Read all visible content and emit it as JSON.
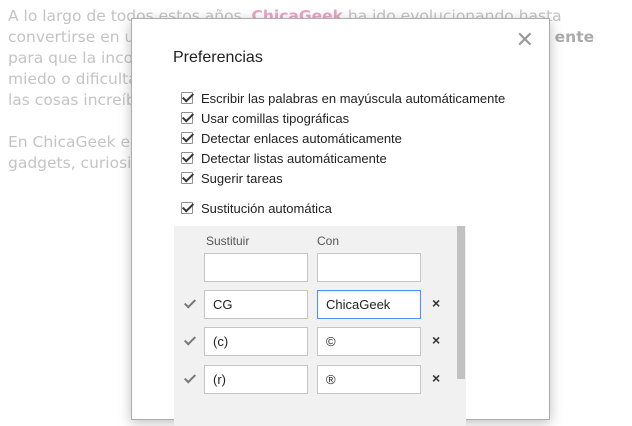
{
  "background": {
    "p1": [
      "A lo largo de todos estos años, ",
      "ChicaGeek",
      " ha ido evolucionando hasta",
      "convertirse en una referencia en el mundo de la tecnología accesible, ",
      "para que la incorporación de la tecnología en la vida de cualquier",
      "miedo o dificultades, y para eso nos esforzamos en enseñarles",
      "las cosas increíbles que hay en el mundo."
    ],
    "p1_bold": "ente",
    "p2": [
      "En ChicaGeek encontrarás noticias, tutoriales, trucos, análisis de",
      "gadgets, curiosidades y todo lo que necesitas saber hoy."
    ]
  },
  "dialog": {
    "title": "Preferencias",
    "close_icon": "close-icon",
    "options": [
      {
        "label": "Escribir las palabras en mayúscula automáticamente",
        "checked": true
      },
      {
        "label": "Usar comillas tipográficas",
        "checked": true
      },
      {
        "label": "Detectar enlaces automáticamente",
        "checked": true
      },
      {
        "label": "Detectar listas automáticamente",
        "checked": true
      },
      {
        "label": "Sugerir tareas",
        "checked": true
      }
    ],
    "auto_sub": {
      "label": "Sustitución automática",
      "checked": true
    },
    "table": {
      "col_replace": "Sustituir",
      "col_with": "Con",
      "new_row": {
        "replace": "",
        "with": ""
      },
      "rows": [
        {
          "checked": true,
          "replace": "CG",
          "with": "ChicaGeek"
        },
        {
          "checked": true,
          "replace": "(c)",
          "with": "©"
        },
        {
          "checked": true,
          "replace": "(r)",
          "with": "®"
        }
      ],
      "delete_glyph": "×"
    }
  }
}
